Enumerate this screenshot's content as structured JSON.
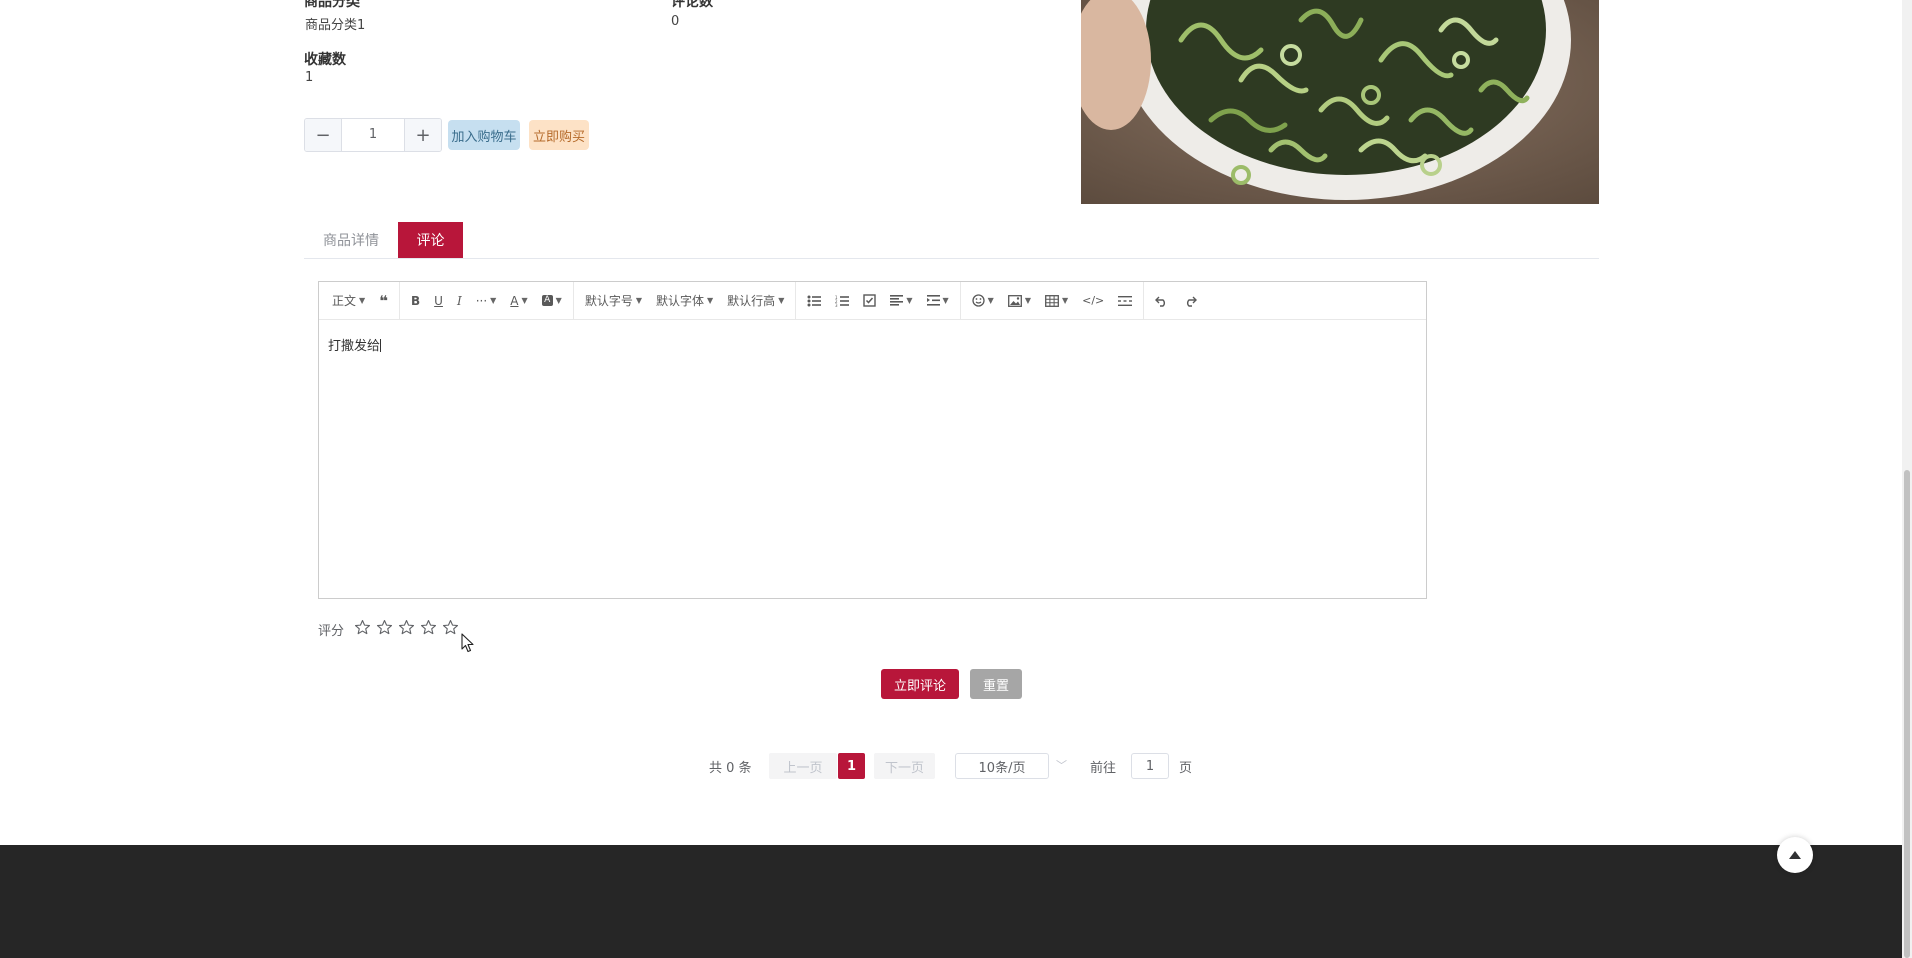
{
  "product_info": {
    "category_label": "商品分类",
    "category_value": "商品分类1",
    "comment_count_label": "评论数",
    "comment_count_value": "0",
    "favorites_label": "收藏数",
    "favorites_value": "1"
  },
  "purchase": {
    "minus": "−",
    "quantity": "1",
    "plus": "+",
    "add_to_cart": "加入购物车",
    "buy_now": "立即购买"
  },
  "tabs": [
    {
      "label": "商品详情",
      "active": false
    },
    {
      "label": "评论",
      "active": true
    }
  ],
  "editor": {
    "toolbar": {
      "paragraph": "正文",
      "font_size": "默认字号",
      "font_family": "默认字体",
      "line_height": "默认行高"
    },
    "content": "打撒发给"
  },
  "rating": {
    "label": "评分",
    "value": 0,
    "max": 5
  },
  "actions": {
    "submit": "立即评论",
    "reset": "重置"
  },
  "pagination": {
    "total": "共 0 条",
    "prev": "上一页",
    "current": "1",
    "next": "下一页",
    "page_size": "10条/页",
    "goto": "前往",
    "goto_value": "1",
    "page_unit": "页"
  },
  "colors": {
    "accent": "#b8163a",
    "footer": "#262626"
  }
}
